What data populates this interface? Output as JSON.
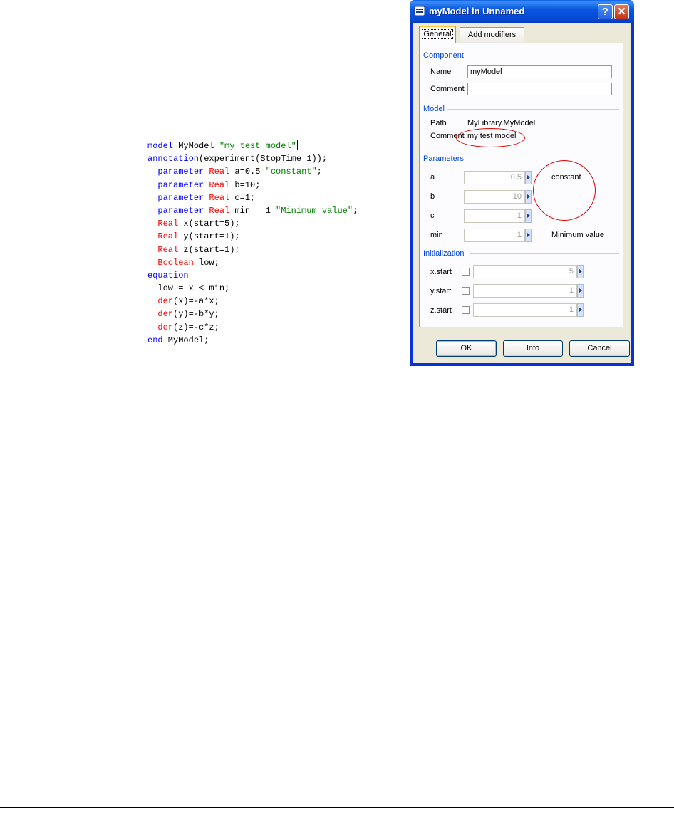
{
  "code": {
    "lines": [
      [
        {
          "t": "model",
          "c": "kw"
        },
        {
          "t": " MyModel ",
          "c": ""
        },
        {
          "t": "\"my test model\"",
          "c": "st"
        }
      ],
      [
        {
          "t": "annotation",
          "c": "kw"
        },
        {
          "t": "(experiment(StopTime=1));",
          "c": ""
        }
      ],
      [
        {
          "t": "  ",
          "c": ""
        },
        {
          "t": "parameter",
          "c": "kw"
        },
        {
          "t": " ",
          "c": ""
        },
        {
          "t": "Real",
          "c": "ty"
        },
        {
          "t": " a=0.5 ",
          "c": ""
        },
        {
          "t": "\"constant\"",
          "c": "st"
        },
        {
          "t": ";",
          "c": ""
        }
      ],
      [
        {
          "t": "  ",
          "c": ""
        },
        {
          "t": "parameter",
          "c": "kw"
        },
        {
          "t": " ",
          "c": ""
        },
        {
          "t": "Real",
          "c": "ty"
        },
        {
          "t": " b=10;",
          "c": ""
        }
      ],
      [
        {
          "t": "  ",
          "c": ""
        },
        {
          "t": "parameter",
          "c": "kw"
        },
        {
          "t": " ",
          "c": ""
        },
        {
          "t": "Real",
          "c": "ty"
        },
        {
          "t": " c=1;",
          "c": ""
        }
      ],
      [
        {
          "t": "  ",
          "c": ""
        },
        {
          "t": "parameter",
          "c": "kw"
        },
        {
          "t": " ",
          "c": ""
        },
        {
          "t": "Real",
          "c": "ty"
        },
        {
          "t": " min = 1 ",
          "c": ""
        },
        {
          "t": "\"Minimum value\"",
          "c": "st"
        },
        {
          "t": ";",
          "c": ""
        }
      ],
      [
        {
          "t": "  ",
          "c": ""
        },
        {
          "t": "Real",
          "c": "ty"
        },
        {
          "t": " x(start=5);",
          "c": ""
        }
      ],
      [
        {
          "t": "  ",
          "c": ""
        },
        {
          "t": "Real",
          "c": "ty"
        },
        {
          "t": " y(start=1);",
          "c": ""
        }
      ],
      [
        {
          "t": "  ",
          "c": ""
        },
        {
          "t": "Real",
          "c": "ty"
        },
        {
          "t": " z(start=1);",
          "c": ""
        }
      ],
      [
        {
          "t": "  ",
          "c": ""
        },
        {
          "t": "Boolean",
          "c": "ty"
        },
        {
          "t": " low;",
          "c": ""
        }
      ],
      [
        {
          "t": "equation",
          "c": "kw"
        }
      ],
      [
        {
          "t": "  low = x < min;",
          "c": ""
        }
      ],
      [
        {
          "t": "  ",
          "c": ""
        },
        {
          "t": "der",
          "c": "ty"
        },
        {
          "t": "(x)=-a*x;",
          "c": ""
        }
      ],
      [
        {
          "t": "  ",
          "c": ""
        },
        {
          "t": "der",
          "c": "ty"
        },
        {
          "t": "(y)=-b*y;",
          "c": ""
        }
      ],
      [
        {
          "t": "  ",
          "c": ""
        },
        {
          "t": "der",
          "c": "ty"
        },
        {
          "t": "(z)=-c*z;",
          "c": ""
        }
      ],
      [
        {
          "t": "end",
          "c": "kw"
        },
        {
          "t": " MyModel;",
          "c": ""
        }
      ]
    ]
  },
  "dialog": {
    "title": "myModel in Unnamed",
    "help_button": "?",
    "close_button": "✕",
    "tabs": {
      "general": "General",
      "add_modifiers": "Add modifiers"
    },
    "component": {
      "heading": "Component",
      "name_label": "Name",
      "name_value": "myModel",
      "comment_label": "Comment",
      "comment_value": ""
    },
    "model": {
      "heading": "Model",
      "path_label": "Path",
      "path_value": "MyLibrary.MyModel",
      "comment_label": "Comment",
      "comment_value": "my test model"
    },
    "parameters": {
      "heading": "Parameters",
      "a_label": "a",
      "a_value": "0.5",
      "a_comment": "constant",
      "b_label": "b",
      "b_value": "10",
      "c_label": "c",
      "c_value": "1",
      "min_label": "min",
      "min_value": "1",
      "min_comment": "Minimum value"
    },
    "initialization": {
      "heading": "Initialization",
      "x_label": "x.start",
      "x_value": "5",
      "x_checked": false,
      "y_label": "y.start",
      "y_value": "1",
      "y_checked": false,
      "z_label": "z.start",
      "z_value": "1",
      "z_checked": false
    },
    "buttons": {
      "ok": "OK",
      "info": "Info",
      "cancel": "Cancel"
    }
  },
  "colors": {
    "keyword": "#0000ff",
    "type": "#ff0000",
    "string": "#008000",
    "annotation_ring": "#e00000",
    "section_heading": "#0046d5"
  }
}
